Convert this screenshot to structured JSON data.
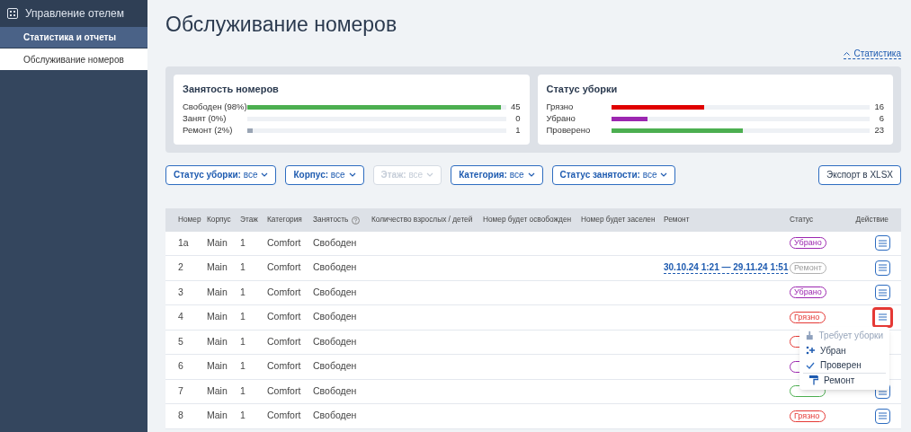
{
  "sidebar": {
    "title": "Управление отелем",
    "items": [
      {
        "label": "Статистика и отчеты",
        "selected": true
      },
      {
        "label": "Обслуживание номеров",
        "selected": false
      }
    ]
  },
  "page_title": "Обслуживание номеров",
  "stats_link": "Статистика",
  "stat_cards": [
    {
      "title": "Занятость номеров",
      "bars": [
        {
          "label": "Свободен (98%)",
          "level": 0.98,
          "color": "#4caf50",
          "value": "45"
        },
        {
          "label": "Занят (0%)",
          "value": "0"
        },
        {
          "label": "Ремонт (2%)",
          "level": 0.02,
          "color": "#9aa5b4",
          "value": "1"
        }
      ]
    },
    {
      "title": "Статус уборки",
      "bars": [
        {
          "label": "Грязно",
          "level": 0.36,
          "color": "#e00000",
          "value": "16"
        },
        {
          "label": "Убрано",
          "level": 0.14,
          "color": "#9c27b0",
          "value": "6"
        },
        {
          "label": "Проверено",
          "level": 0.51,
          "color": "#4caf50",
          "value": "23"
        }
      ]
    }
  ],
  "filters": [
    {
      "label": "Статус уборки:",
      "value": "все",
      "disabled": false
    },
    {
      "label": "Корпус:",
      "value": "все",
      "disabled": false
    },
    {
      "label": "Этаж:",
      "value": "все",
      "disabled": true
    },
    {
      "label": "Категория:",
      "value": "все",
      "disabled": false
    },
    {
      "label": "Статус занятости:",
      "value": "все",
      "disabled": false
    }
  ],
  "export_button": "Экспорт в XLSX",
  "table": {
    "columns": [
      "Номер",
      "Корпус",
      "Этаж",
      "Категория",
      "Занятость",
      "Количество взрослых / детей",
      "Номер будет освобожден",
      "Номер будет заселен",
      "Ремонт",
      "Статус",
      "Действие"
    ],
    "rows": [
      {
        "number": "1a",
        "building": "Main",
        "floor": "1",
        "category": "Comfort",
        "occupancy": "Свободен",
        "status": {
          "kind": "clean",
          "label": "Убрано"
        },
        "highlighted": false
      },
      {
        "number": "2",
        "building": "Main",
        "floor": "1",
        "category": "Comfort",
        "occupancy": "Свободен",
        "repair": "30.10.24 1:21 — 29.11.24 1:51",
        "status": {
          "kind": "repair",
          "label": "Ремонт"
        },
        "highlighted": false
      },
      {
        "number": "3",
        "building": "Main",
        "floor": "1",
        "category": "Comfort",
        "occupancy": "Свободен",
        "status": {
          "kind": "clean",
          "label": "Убрано"
        },
        "highlighted": false
      },
      {
        "number": "4",
        "building": "Main",
        "floor": "1",
        "category": "Comfort",
        "occupancy": "Свободен",
        "status": {
          "kind": "dirty",
          "label": "Грязно"
        },
        "highlighted": true
      },
      {
        "number": "5",
        "building": "Main",
        "floor": "1",
        "category": "Comfort",
        "occupancy": "Свободен",
        "status": {
          "kind": "dirty"
        }
      },
      {
        "number": "6",
        "building": "Main",
        "floor": "1",
        "category": "Comfort",
        "occupancy": "Свободен",
        "status": {
          "kind": "clean"
        }
      },
      {
        "number": "7",
        "building": "Main",
        "floor": "1",
        "category": "Comfort",
        "occupancy": "Свободен",
        "status": {
          "kind": "checked"
        },
        "highlighted": false
      },
      {
        "number": "8",
        "building": "Main",
        "floor": "1",
        "category": "Comfort",
        "occupancy": "Свободен",
        "status": {
          "kind": "dirty",
          "label": "Грязно"
        },
        "highlighted": false
      }
    ]
  },
  "action_menu": [
    {
      "kind": "needs-cleaning",
      "label": "Требует уборки",
      "disabled": true
    },
    {
      "kind": "cleaned",
      "label": "Убран",
      "disabled": false
    },
    {
      "kind": "checked",
      "label": "Проверен",
      "disabled": false
    },
    {
      "kind": "repair",
      "label": "Ремонт",
      "disabled": false
    }
  ]
}
